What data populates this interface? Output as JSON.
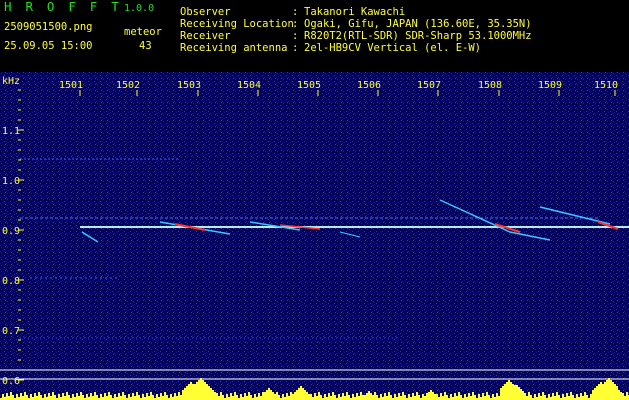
{
  "header": {
    "app_name": "H R O F F T",
    "app_version": "1.0.0",
    "filename": "2509051500.png",
    "datetime": "25.09.05 15:00",
    "meteor_label": "meteor",
    "meteor_count": "43",
    "meta": [
      {
        "label": "Observer",
        "value": "Takanori Kawachi"
      },
      {
        "label": "Receiving Location",
        "value": "Ogaki, Gifu, JAPAN (136.60E, 35.35N)"
      },
      {
        "label": "Receiver",
        "value": "R820T2(RTL-SDR) SDR-Sharp 53.1000MHz"
      },
      {
        "label": "Receiving antenna",
        "value": "2el-HB9CV Vertical (el. E-W)"
      }
    ],
    "colon": ":"
  },
  "plot": {
    "y_unit": "kHz",
    "x_ticks": [
      "1501",
      "1502",
      "1503",
      "1504",
      "1505",
      "1506",
      "1507",
      "1508",
      "1509",
      "1510"
    ],
    "y_ticks": [
      "1.1",
      "1.0",
      "0.9",
      "0.8",
      "0.7",
      "0.6"
    ],
    "colors": {
      "background": "#02025a",
      "axis": "#ffff33",
      "carrier": "#9fe8ff",
      "echo_hot": "#ff3030",
      "echo": "#38c8ff"
    }
  }
}
